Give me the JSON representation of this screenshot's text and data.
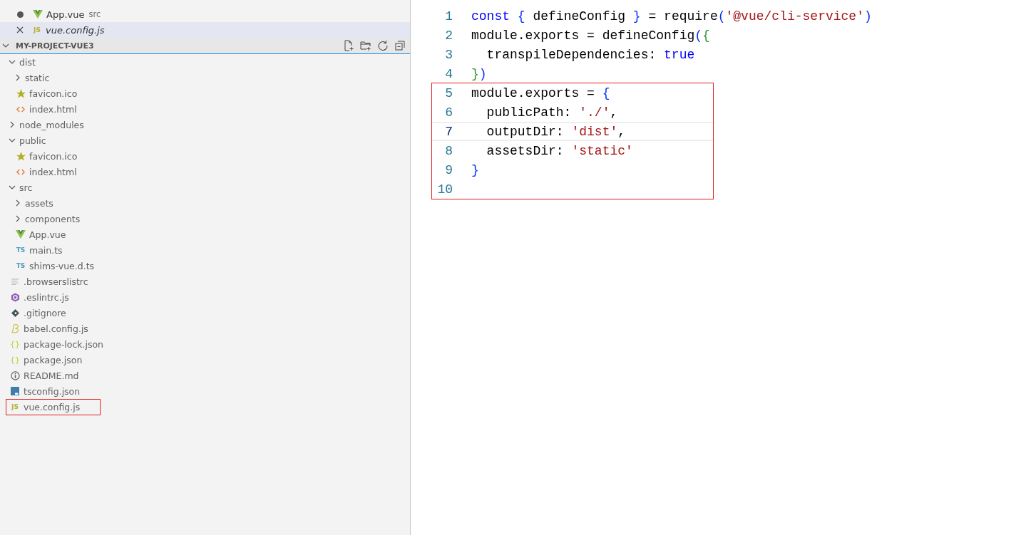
{
  "open_editors": [
    {
      "name": "App.vue",
      "description": "src",
      "kind": "vue",
      "dirty": true,
      "selected": false
    },
    {
      "name": "vue.config.js",
      "kind": "js",
      "icon_text": "JS",
      "dirty": false,
      "selected": true
    }
  ],
  "explorer": {
    "title": "MY-PROJECT-VUE3",
    "tree": [
      {
        "name": "dist",
        "kind": "folder",
        "expanded": true,
        "children": [
          {
            "name": "static",
            "kind": "folder",
            "expanded": false
          },
          {
            "name": "favicon.ico",
            "kind": "star"
          },
          {
            "name": "index.html",
            "kind": "html"
          }
        ]
      },
      {
        "name": "node_modules",
        "kind": "folder",
        "expanded": false
      },
      {
        "name": "public",
        "kind": "folder",
        "expanded": true,
        "children": [
          {
            "name": "favicon.ico",
            "kind": "star"
          },
          {
            "name": "index.html",
            "kind": "html"
          }
        ]
      },
      {
        "name": "src",
        "kind": "folder",
        "expanded": true,
        "children": [
          {
            "name": "assets",
            "kind": "folder",
            "expanded": false
          },
          {
            "name": "components",
            "kind": "folder",
            "expanded": false
          },
          {
            "name": "App.vue",
            "kind": "vue"
          },
          {
            "name": "main.ts",
            "kind": "ts",
            "icon_text": "TS"
          },
          {
            "name": "shims-vue.d.ts",
            "kind": "ts",
            "icon_text": "TS"
          }
        ]
      },
      {
        "name": ".browserslistrc",
        "kind": "lines"
      },
      {
        "name": ".eslintrc.js",
        "kind": "eslint"
      },
      {
        "name": ".gitignore",
        "kind": "git"
      },
      {
        "name": "babel.config.js",
        "kind": "babel"
      },
      {
        "name": "package-lock.json",
        "kind": "json",
        "icon_text": "{}"
      },
      {
        "name": "package.json",
        "kind": "json",
        "icon_text": "{}"
      },
      {
        "name": "README.md",
        "kind": "info"
      },
      {
        "name": "tsconfig.json",
        "kind": "tsconfig"
      },
      {
        "name": "vue.config.js",
        "kind": "js",
        "icon_text": "JS",
        "boxed": true
      }
    ]
  },
  "editor": {
    "lines": [
      {
        "number": "1",
        "current": false,
        "boxed": false,
        "tokens": [
          {
            "t": "const",
            "color": "#0000ff"
          },
          {
            "t": " {",
            "color": "#0431fa"
          },
          {
            "t": " defineConfig ",
            "color": "#000000"
          },
          {
            "t": "}",
            "color": "#0431fa"
          },
          {
            "t": " = require",
            "color": "#000000"
          },
          {
            "t": "(",
            "color": "#0431fa"
          },
          {
            "t": "'@vue/cli-service'",
            "color": "#a31515"
          },
          {
            "t": ")",
            "color": "#0431fa"
          }
        ]
      },
      {
        "number": "2",
        "current": false,
        "boxed": false,
        "tokens": [
          {
            "t": "module.exports = defineConfig",
            "color": "#000000"
          },
          {
            "t": "(",
            "color": "#0431fa"
          },
          {
            "t": "{",
            "color": "#319331"
          }
        ]
      },
      {
        "number": "3",
        "current": false,
        "boxed": false,
        "tokens": [
          {
            "t": "  transpileDependencies: ",
            "color": "#000000"
          },
          {
            "t": "true",
            "color": "#0000ff"
          }
        ]
      },
      {
        "number": "4",
        "current": false,
        "boxed": false,
        "tokens": [
          {
            "t": "}",
            "color": "#319331"
          },
          {
            "t": ")",
            "color": "#0431fa"
          }
        ]
      },
      {
        "number": "5",
        "current": false,
        "boxed": true,
        "tokens": [
          {
            "t": "module.exports = ",
            "color": "#000000"
          },
          {
            "t": "{",
            "color": "#0431fa"
          }
        ]
      },
      {
        "number": "6",
        "current": false,
        "boxed": true,
        "tokens": [
          {
            "t": "  publicPath: ",
            "color": "#000000"
          },
          {
            "t": "'./'",
            "color": "#a31515"
          },
          {
            "t": ",",
            "color": "#000000"
          }
        ]
      },
      {
        "number": "7",
        "current": true,
        "boxed": true,
        "tokens": [
          {
            "t": "  outputDir: ",
            "color": "#000000"
          },
          {
            "t": "'dist'",
            "color": "#a31515"
          },
          {
            "t": ",",
            "color": "#000000"
          }
        ]
      },
      {
        "number": "8",
        "current": false,
        "boxed": true,
        "tokens": [
          {
            "t": "  assetsDir: ",
            "color": "#000000"
          },
          {
            "t": "'static'",
            "color": "#a31515"
          }
        ]
      },
      {
        "number": "9",
        "current": false,
        "boxed": true,
        "tokens": [
          {
            "t": "}",
            "color": "#0431fa"
          }
        ]
      },
      {
        "number": "10",
        "current": false,
        "boxed": true
      }
    ]
  }
}
